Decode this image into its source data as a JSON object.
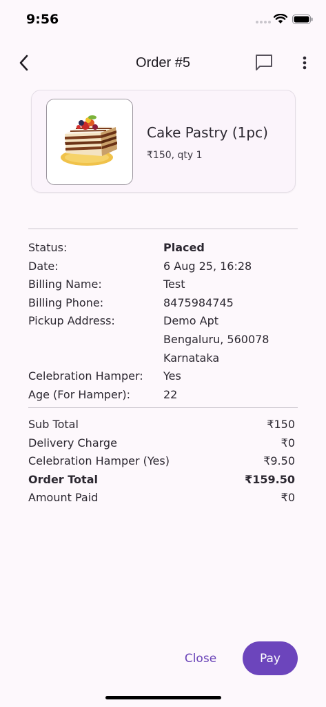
{
  "status_bar": {
    "time": "9:56"
  },
  "header": {
    "title": "Order #5",
    "back_icon": "chevron-left-icon",
    "chat_icon": "message-square-icon",
    "more_icon": "more-vertical-icon"
  },
  "product": {
    "name": "Cake Pastry (1pc)",
    "meta": "₹150, qty 1",
    "image": "cake-pastry-photo"
  },
  "details": {
    "status_label": "Status:",
    "status_value": "Placed",
    "date_label": "Date:",
    "date_value": "6 Aug 25, 16:28",
    "billing_name_label": "Billing Name:",
    "billing_name_value": "Test",
    "billing_phone_label": "Billing Phone:",
    "billing_phone_value": "8475984745",
    "pickup_address_label": "Pickup Address:",
    "pickup_address_lines": [
      "Demo Apt",
      "Bengaluru, 560078",
      "Karnataka"
    ],
    "hamper_label": "Celebration Hamper:",
    "hamper_value": "Yes",
    "age_label": "Age (For Hamper):",
    "age_value": "22"
  },
  "totals": {
    "sub_total_label": "Sub Total",
    "sub_total_value": "₹150",
    "delivery_label": "Delivery Charge",
    "delivery_value": "₹0",
    "hamper_label": "Celebration Hamper (Yes)",
    "hamper_value": "₹9.50",
    "order_total_label": "Order Total",
    "order_total_value": "₹159.50",
    "amount_paid_label": "Amount Paid",
    "amount_paid_value": "₹0"
  },
  "actions": {
    "close_label": "Close",
    "pay_label": "Pay"
  },
  "colors": {
    "accent": "#6c45bc",
    "background": "#fdf8fc",
    "card": "#fbf4fb"
  }
}
